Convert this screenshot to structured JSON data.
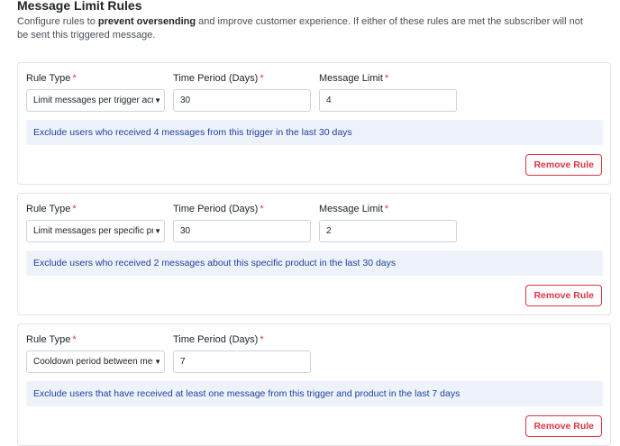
{
  "section": {
    "title": "Message Limit Rules",
    "desc_before": "Configure rules to ",
    "desc_bold": "prevent oversending",
    "desc_after": " and improve customer experience. If either of these rules are met the subscriber will not be sent this triggered message."
  },
  "labels": {
    "rule_type": "Rule Type",
    "time_period": "Time Period (Days)",
    "message_limit": "Message Limit",
    "required_mark": "*",
    "remove_button": "Remove Rule"
  },
  "rules": [
    {
      "rule_type": "Limit messages per trigger across",
      "time_period": "30",
      "message_limit": "4",
      "info": "Exclude users who received 4 messages from this trigger in the last 30 days"
    },
    {
      "rule_type": "Limit messages per specific product",
      "time_period": "30",
      "message_limit": "2",
      "info": "Exclude users who received 2 messages about this specific product in the last 30 days"
    },
    {
      "rule_type": "Cooldown period between messages",
      "time_period": "7",
      "info": "Exclude users that have received at least one message from this trigger and product in the last 7 days"
    }
  ],
  "colors": {
    "required": "#dc3545",
    "info_bg": "#eef3fb",
    "info_text": "#1d3f9e",
    "danger": "#dc3545"
  },
  "icons": {
    "select_caret": "chevron-down-icon"
  }
}
